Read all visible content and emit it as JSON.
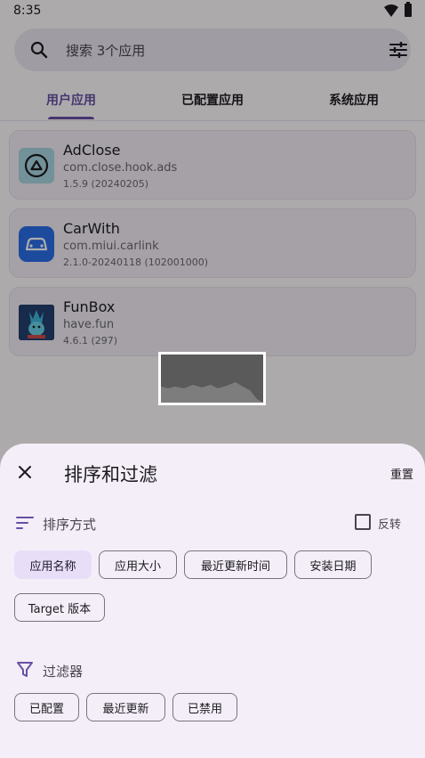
{
  "status_bar": {
    "time": "8:35"
  },
  "search": {
    "placeholder": "搜索 3个应用"
  },
  "tabs": [
    {
      "label": "用户应用",
      "active": true
    },
    {
      "label": "已配置应用",
      "active": false
    },
    {
      "label": "系统应用",
      "active": false
    }
  ],
  "apps": [
    {
      "name": "AdClose",
      "package": "com.close.hook.ads",
      "version": "1.5.9 (20240205)",
      "icon": "adclose-icon"
    },
    {
      "name": "CarWith",
      "package": "com.miui.carlink",
      "version": "2.1.0-20240118 (102001000)",
      "icon": "carwith-icon"
    },
    {
      "name": "FunBox",
      "package": "have.fun",
      "version": "4.6.1 (297)",
      "icon": "funbox-icon"
    }
  ],
  "sheet": {
    "title": "排序和过滤",
    "reset_label": "重置",
    "sort": {
      "label": "排序方式",
      "reverse_label": "反转",
      "reverse_checked": false,
      "options": [
        {
          "label": "应用名称",
          "selected": true
        },
        {
          "label": "应用大小",
          "selected": false
        },
        {
          "label": "最近更新时间",
          "selected": false
        },
        {
          "label": "安装日期",
          "selected": false
        },
        {
          "label": "Target 版本",
          "selected": false
        }
      ]
    },
    "filter": {
      "label": "过滤器",
      "options": [
        {
          "label": "已配置",
          "selected": false
        },
        {
          "label": "最近更新",
          "selected": false
        },
        {
          "label": "已禁用",
          "selected": false
        }
      ]
    }
  },
  "colors": {
    "accent": "#6750a4",
    "chip_selected": "#e8def8",
    "sheet_bg": "#f4eef8"
  }
}
